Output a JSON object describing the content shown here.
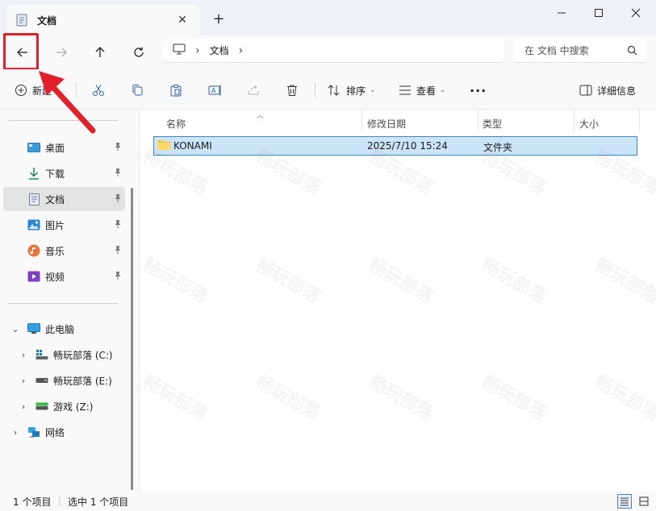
{
  "titlebar": {
    "tab_title": "文档",
    "tab_icon": "document-icon",
    "new_tab": "+"
  },
  "address": {
    "crumbs": [
      "文档"
    ],
    "search_placeholder": "在 文档 中搜索"
  },
  "commandbar": {
    "new_label": "新建",
    "sort_label": "排序",
    "view_label": "查看",
    "more_label": "···",
    "details_label": "详细信息"
  },
  "sidebar": {
    "quick_access": [
      {
        "label": "桌面",
        "icon": "desktop-icon",
        "pinned": true
      },
      {
        "label": "下载",
        "icon": "download-icon",
        "pinned": true
      },
      {
        "label": "文档",
        "icon": "document-icon",
        "pinned": true,
        "selected": true
      },
      {
        "label": "图片",
        "icon": "pictures-icon",
        "pinned": true
      },
      {
        "label": "音乐",
        "icon": "music-icon",
        "pinned": true
      },
      {
        "label": "视频",
        "icon": "video-icon",
        "pinned": true
      }
    ],
    "tree": [
      {
        "label": "此电脑",
        "icon": "pc-icon",
        "expanded": true
      },
      {
        "label": "畅玩部落 (C:)",
        "icon": "drive-c-icon",
        "expanded": false
      },
      {
        "label": "畅玩部落 (E:)",
        "icon": "drive-icon",
        "expanded": false
      },
      {
        "label": "游戏 (Z:)",
        "icon": "drive-green-icon",
        "expanded": false
      },
      {
        "label": "网络",
        "icon": "network-icon",
        "expanded": false
      }
    ]
  },
  "content": {
    "columns": [
      "名称",
      "修改日期",
      "类型",
      "大小"
    ],
    "rows": [
      {
        "name": "KONAMI",
        "modified": "2025/7/10 15:24",
        "type": "文件夹",
        "size": ""
      }
    ],
    "watermark": "畅玩部落"
  },
  "status": {
    "item_count": "1 个项目",
    "selected_count": "选中 1 个项目"
  },
  "colors": {
    "highlight_red": "#e0202a",
    "selection_blue": "#cce4f7",
    "selection_border": "#3b86c4"
  }
}
